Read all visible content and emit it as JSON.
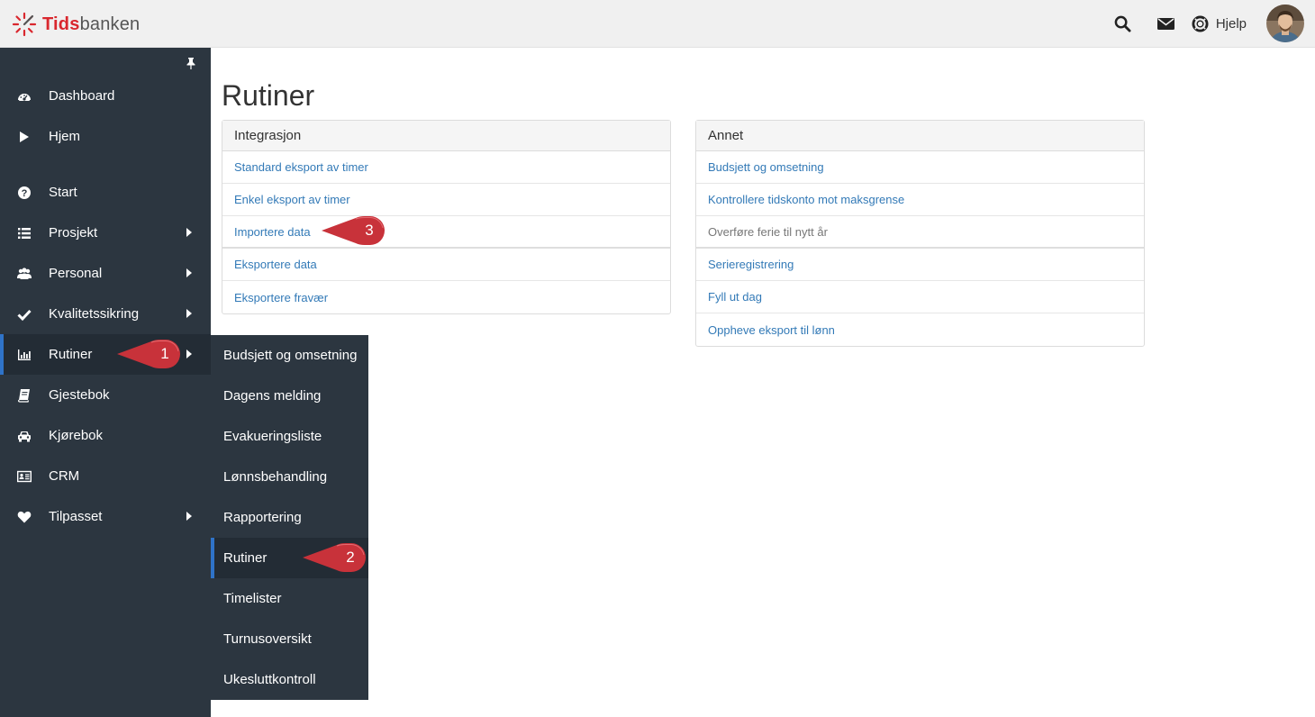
{
  "brand": {
    "name_part1": "Tids",
    "name_part2": "banken",
    "accent": "#d9272e"
  },
  "topbar": {
    "icons": [
      "search-icon",
      "envelope-icon",
      "life-ring-icon"
    ],
    "help_label": "Hjelp"
  },
  "sidebar": {
    "items": [
      {
        "label": "Dashboard",
        "icon": "dashboard-icon",
        "has_submenu": false
      },
      {
        "label": "Hjem",
        "icon": "play-icon",
        "has_submenu": false
      },
      {
        "label": "Start",
        "icon": "question-icon",
        "has_submenu": false
      },
      {
        "label": "Prosjekt",
        "icon": "list-icon",
        "has_submenu": true
      },
      {
        "label": "Personal",
        "icon": "users-icon",
        "has_submenu": true
      },
      {
        "label": "Kvalitetssikring",
        "icon": "check-icon",
        "has_submenu": true
      },
      {
        "label": "Rutiner",
        "icon": "bar-chart-icon",
        "has_submenu": true,
        "active": true
      },
      {
        "label": "Gjestebok",
        "icon": "book-icon",
        "has_submenu": false
      },
      {
        "label": "Kjørebok",
        "icon": "car-icon",
        "has_submenu": false
      },
      {
        "label": "CRM",
        "icon": "id-card-icon",
        "has_submenu": false
      },
      {
        "label": "Tilpasset",
        "icon": "heart-icon",
        "has_submenu": true
      }
    ]
  },
  "submenu": {
    "items": [
      {
        "label": "Budsjett og omsetning"
      },
      {
        "label": "Dagens melding"
      },
      {
        "label": "Evakueringsliste"
      },
      {
        "label": "Lønnsbehandling"
      },
      {
        "label": "Rapportering"
      },
      {
        "label": "Rutiner",
        "active": true
      },
      {
        "label": "Timelister"
      },
      {
        "label": "Turnusoversikt"
      },
      {
        "label": "Ukesluttkontroll"
      }
    ]
  },
  "main": {
    "title": "Rutiner",
    "panels": [
      {
        "heading": "Integrasjon",
        "links": [
          "Standard eksport av timer",
          "Enkel eksport av timer",
          "Importere data",
          "Eksportere data",
          "Eksportere fravær"
        ]
      },
      {
        "heading": "Annet",
        "links": [
          "Budsjett og omsetning",
          "Kontrollere tidskonto mot maksgrense",
          "Overføre ferie til nytt år",
          "Serieregistrering",
          "Fyll ut dag",
          "Oppheve eksport til lønn"
        ]
      }
    ]
  },
  "callouts": [
    "1",
    "2",
    "3"
  ],
  "colors": {
    "sidebar_bg": "#2c3640",
    "active_bg": "#232c35",
    "active_bar": "#2f73c8",
    "link": "#337ab7",
    "callout": "#c8323a"
  }
}
